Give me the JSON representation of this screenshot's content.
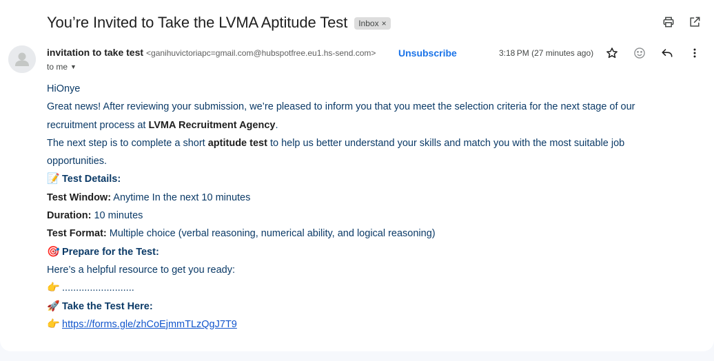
{
  "subject": "You’re Invited to Take the LVMA Aptitude Test",
  "label": "Inbox",
  "label_close": "×",
  "top_actions": [
    "print-icon",
    "open-in-new-window-icon"
  ],
  "sender": {
    "name": "invitation to take test",
    "email": "<ganihuvictoriapc=gmail.com@hubspotfree.eu1.hs-send.com>",
    "unsubscribe": "Unsubscribe",
    "time": "3:18 PM (27 minutes ago)",
    "to": "to me"
  },
  "header_actions": [
    "star-icon",
    "emoji-react-icon",
    "reply-icon",
    "more-vert-icon"
  ],
  "body": {
    "greeting": "HiOnye",
    "p1_a": "Great news! After reviewing your submission, we’re pleased to inform you that you meet the selection criteria for the next stage of our recruitment process at ",
    "p1_bold": "LVMA Recruitment Agency",
    "p1_end": ".",
    "p2_a": "The next step is to complete a short ",
    "p2_bold": "aptitude test",
    "p2_b": " to help us better understand your skills and match you with the most suitable job opportunities.",
    "details_emoji": "📝",
    "details_heading": "Test Details:",
    "window_label": "Test Window:",
    "window_value": " Anytime In the next 10 minutes",
    "duration_label": "Duration:",
    "duration_value": " 10 minutes",
    "format_label": "Test Format:",
    "format_value": " Multiple choice (verbal reasoning, numerical ability, and logical reasoning)",
    "prepare_emoji": "🎯",
    "prepare_heading": "Prepare for the Test:",
    "resource_line": "Here’s a helpful resource to get you ready:",
    "point_emoji": "👉",
    "dots": " ..........................",
    "take_emoji": "🚀",
    "take_heading": "Take the Test Here:",
    "link_text": "https://forms.gle/zhCoEjmmTLzQgJ7T9"
  }
}
